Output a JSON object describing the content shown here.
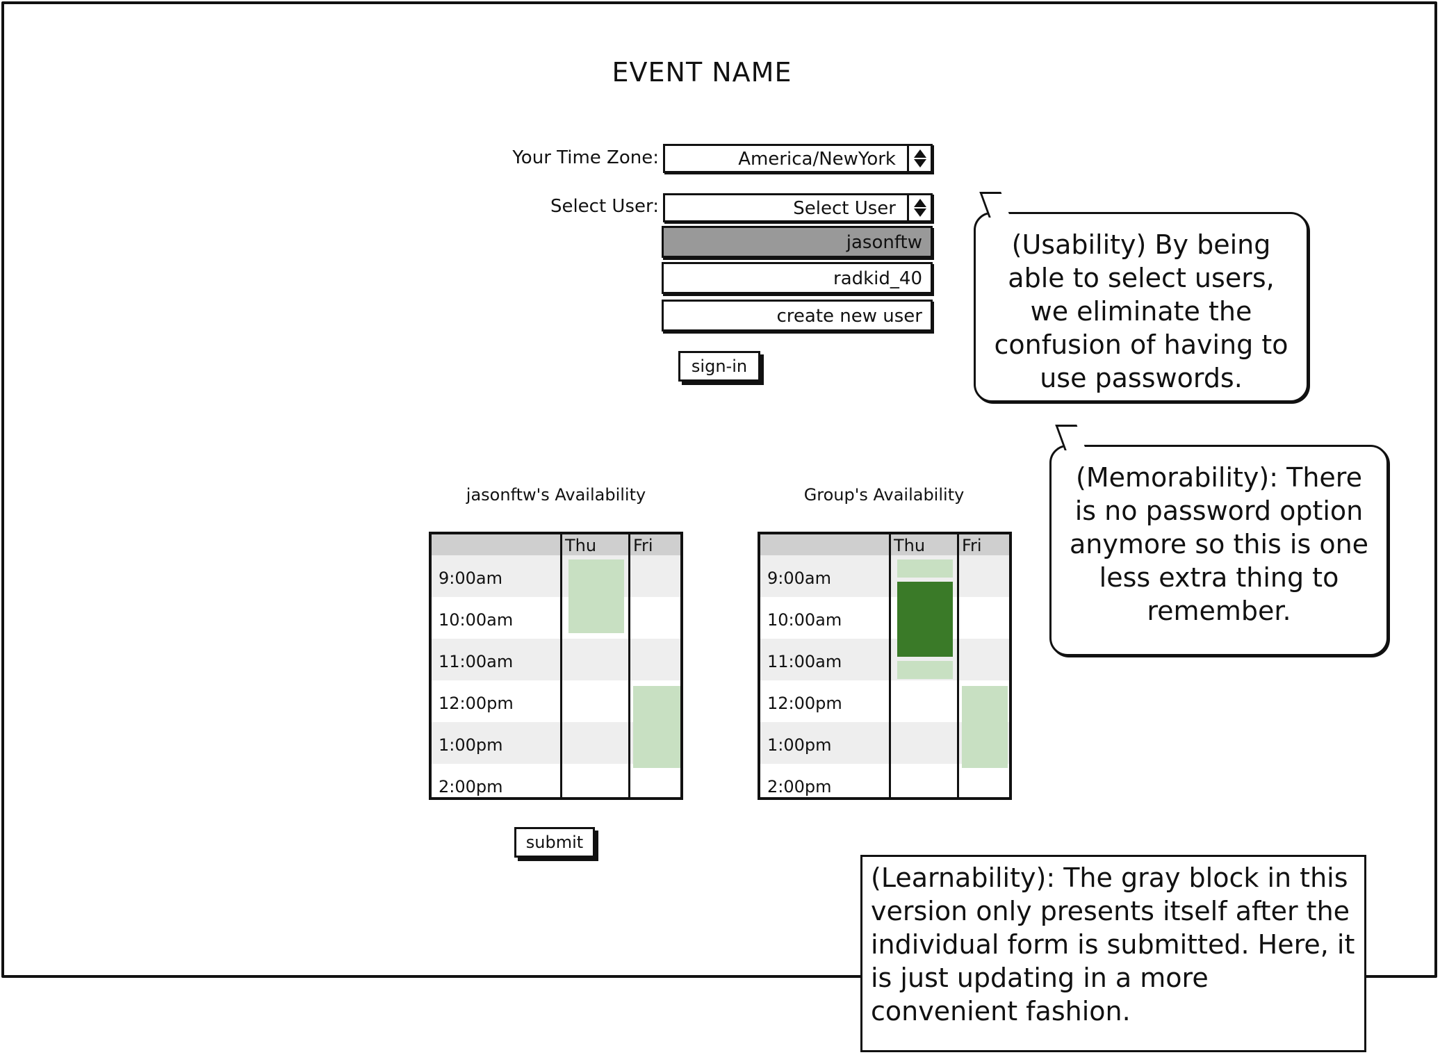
{
  "page": {
    "title": "EVENT NAME"
  },
  "timezone": {
    "label": "Your Time Zone:",
    "selected": "America/NewYork"
  },
  "user_select": {
    "label": "Select User:",
    "selected": "Select User",
    "options": [
      {
        "label": "jasonftw",
        "highlighted": true
      },
      {
        "label": "radkid_40",
        "highlighted": false
      },
      {
        "label": "create new user",
        "highlighted": false
      }
    ]
  },
  "buttons": {
    "sign_in": "sign-in",
    "submit": "submit"
  },
  "availability": {
    "days": [
      "Thu",
      "Fri"
    ],
    "times": [
      "9:00am",
      "10:00am",
      "11:00am",
      "12:00pm",
      "1:00pm",
      "2:00pm"
    ],
    "personal": {
      "title": "jasonftw's Availability"
    },
    "group": {
      "title": "Group's Availability"
    }
  },
  "annotations": {
    "usability": "(Usability) By being able to select users, we eliminate the confusion of having to use passwords.",
    "memorability": "(Memorability): There is no password option anymore so this is one less extra thing to remember.",
    "learnability": "(Learnability): The gray block in this version only presents itself after the individual form is submitted. Here, it is just updating in a more convenient fashion."
  },
  "colors": {
    "available_light": "#c8e0c2",
    "available_dark": "#3a7a28",
    "selected_option": "#999999",
    "header": "#cfcfcf",
    "row_shade": "#eeeeee"
  }
}
